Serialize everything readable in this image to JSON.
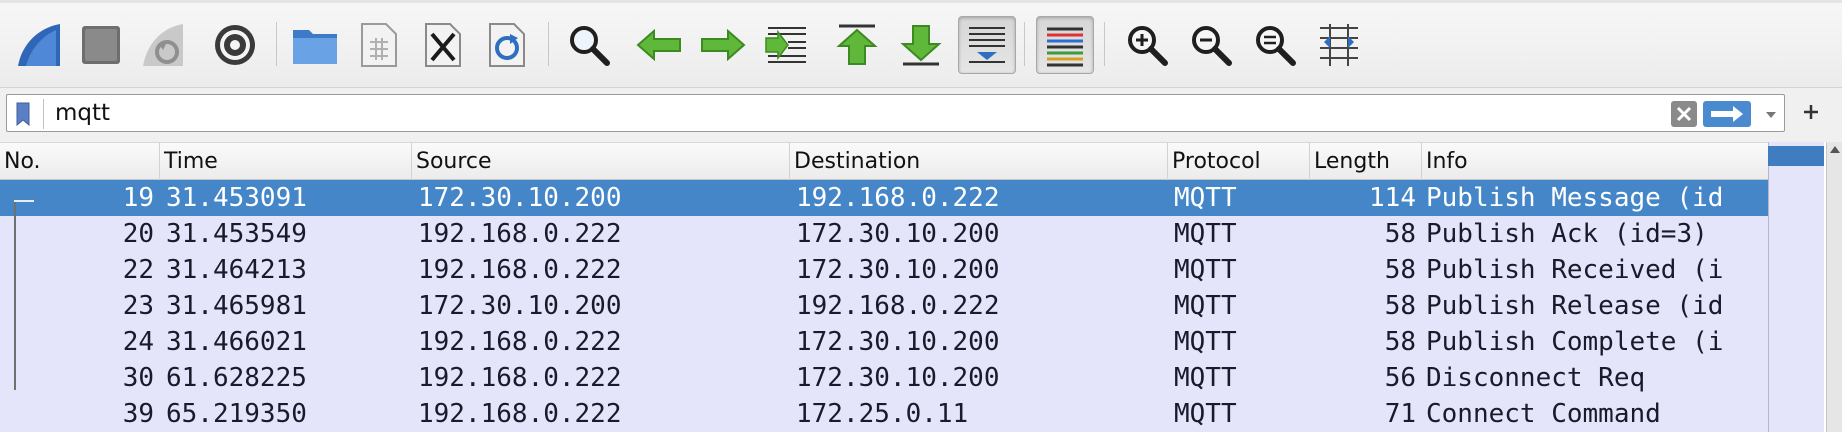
{
  "toolbar": {
    "buttons": [
      {
        "icon": "shark-fin-start-icon"
      },
      {
        "icon": "stop-square-icon"
      },
      {
        "icon": "restart-fin-icon"
      },
      {
        "icon": "capture-options-gear-icon"
      },
      {
        "icon": "open-folder-icon"
      },
      {
        "icon": "save-file-icon"
      },
      {
        "icon": "close-file-icon"
      },
      {
        "icon": "reload-file-icon"
      },
      {
        "icon": "find-packet-magnifier-icon"
      },
      {
        "icon": "go-back-arrow-icon"
      },
      {
        "icon": "go-forward-arrow-icon"
      },
      {
        "icon": "go-to-packet-icon"
      },
      {
        "icon": "first-packet-icon"
      },
      {
        "icon": "last-packet-icon"
      },
      {
        "icon": "autoscroll-icon"
      },
      {
        "icon": "colorize-icon"
      },
      {
        "icon": "zoom-in-icon"
      },
      {
        "icon": "zoom-out-icon"
      },
      {
        "icon": "normal-size-icon"
      },
      {
        "icon": "resize-columns-icon"
      }
    ]
  },
  "filter": {
    "value": "mqtt",
    "colors": {
      "bookmark": "#5b7fc4",
      "apply": "#4a8bd0"
    }
  },
  "packet_list": {
    "columns": [
      "No.",
      "Time",
      "Source",
      "Destination",
      "Protocol",
      "Length",
      "Info"
    ],
    "rows": [
      {
        "no": "19",
        "time": "31.453091",
        "source": "172.30.10.200",
        "destination": "192.168.0.222",
        "protocol": "MQTT",
        "length": "114",
        "info": "Publish Message (id",
        "selected": true
      },
      {
        "no": "20",
        "time": "31.453549",
        "source": "192.168.0.222",
        "destination": "172.30.10.200",
        "protocol": "MQTT",
        "length": "58",
        "info": "Publish Ack (id=3)"
      },
      {
        "no": "22",
        "time": "31.464213",
        "source": "192.168.0.222",
        "destination": "172.30.10.200",
        "protocol": "MQTT",
        "length": "58",
        "info": "Publish Received (i"
      },
      {
        "no": "23",
        "time": "31.465981",
        "source": "172.30.10.200",
        "destination": "192.168.0.222",
        "protocol": "MQTT",
        "length": "58",
        "info": "Publish Release (id"
      },
      {
        "no": "24",
        "time": "31.466021",
        "source": "192.168.0.222",
        "destination": "172.30.10.200",
        "protocol": "MQTT",
        "length": "58",
        "info": "Publish Complete (i"
      },
      {
        "no": "30",
        "time": "61.628225",
        "source": "192.168.0.222",
        "destination": "172.30.10.200",
        "protocol": "MQTT",
        "length": "56",
        "info": "Disconnect Req"
      },
      {
        "no": "39",
        "time": "65.219350",
        "source": "192.168.0.222",
        "destination": "172.25.0.11",
        "protocol": "MQTT",
        "length": "71",
        "info": "Connect Command"
      }
    ],
    "colors": {
      "row": "#e4e4fa",
      "selected": "#4586c8"
    }
  }
}
